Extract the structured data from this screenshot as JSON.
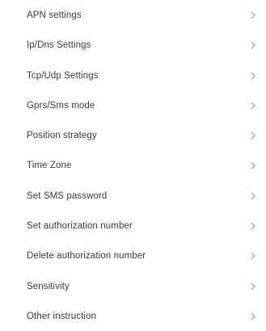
{
  "settings": {
    "items": [
      {
        "label": "APN settings"
      },
      {
        "label": "Ip/Dns Settings"
      },
      {
        "label": "Tcp/Udp Settings"
      },
      {
        "label": "Gprs/Sms mode"
      },
      {
        "label": "Position strategy"
      },
      {
        "label": "Time Zone"
      },
      {
        "label": "Set SMS password"
      },
      {
        "label": "Set authorization number"
      },
      {
        "label": "Delete authorization number"
      },
      {
        "label": "Sensitivity"
      },
      {
        "label": "Other instruction"
      }
    ],
    "chevron_icon": "chevron-right-icon",
    "colors": {
      "text": "#3a3a3a",
      "chevron": "#9a9a9a",
      "background": "#ffffff"
    }
  }
}
